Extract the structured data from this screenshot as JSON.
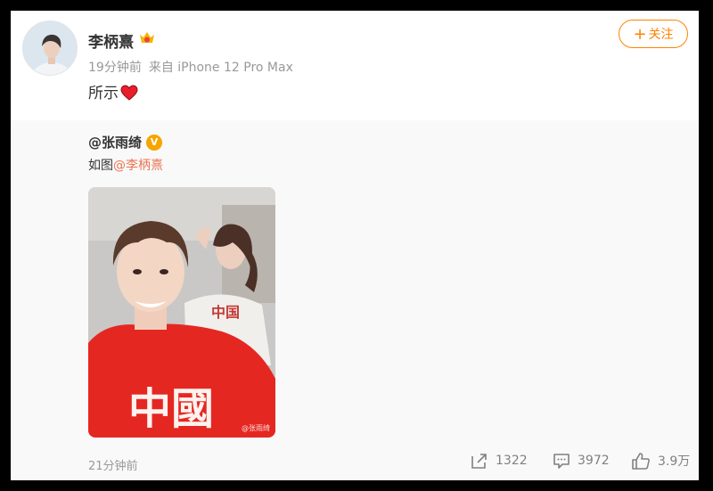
{
  "post": {
    "username": "李柄熹",
    "time": "19分钟前",
    "source": "来自 iPhone 12 Pro Max",
    "text": "所示",
    "follow_label": "关注",
    "follow_icon": "plus-icon",
    "text_emoji": "heart-icon",
    "badge_icon": "vip-crown-icon"
  },
  "repost": {
    "author": "@张雨绮",
    "verified_icon": "verified-v-icon",
    "text_prefix": "如图",
    "mention": "@李柄熹",
    "photo_watermark": "@张雨绮",
    "timestamp": "21分钟前",
    "actions": {
      "reposts": "1322",
      "comments": "3972",
      "likes": "3.9万"
    }
  },
  "colors": {
    "accent": "#ff8200",
    "mention": "#eb7350",
    "muted": "#999999",
    "repost_bg": "#f9f9f9"
  }
}
